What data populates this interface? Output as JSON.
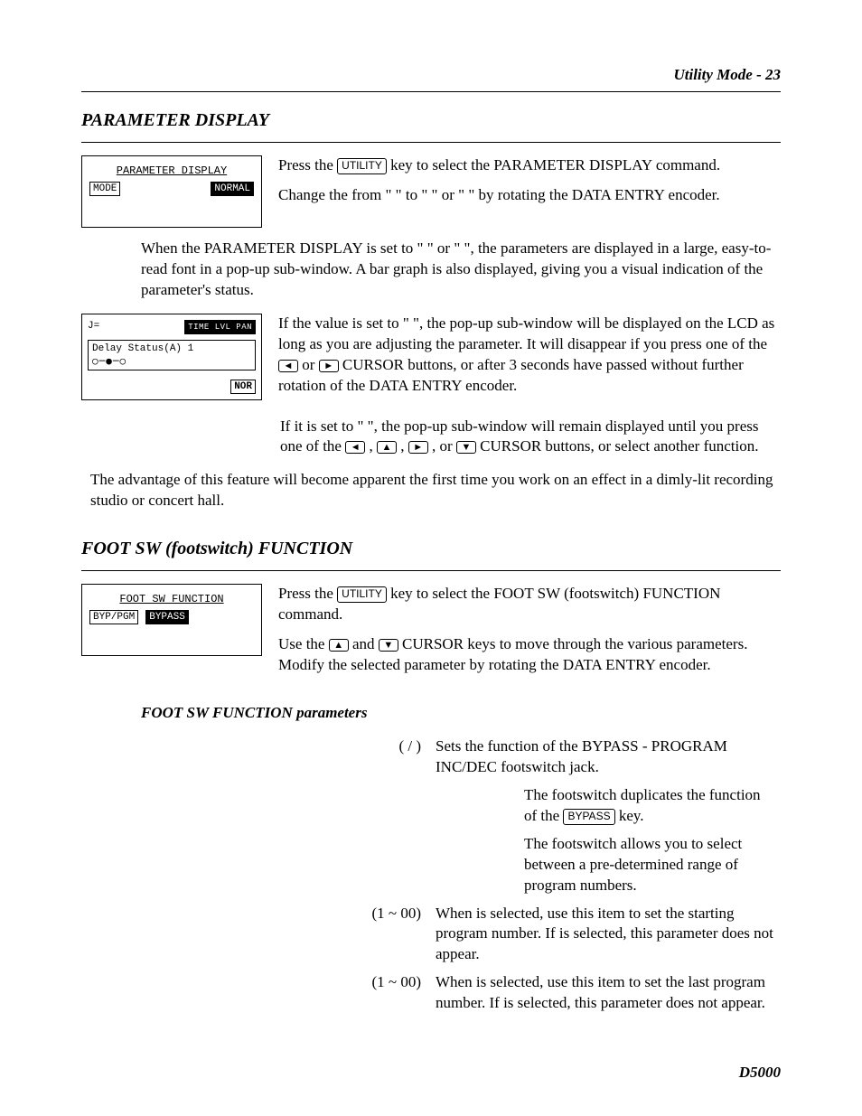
{
  "header": {
    "running_head": "Utility Mode - 23",
    "model": "D5000"
  },
  "section1": {
    "title": "PARAMETER DISPLAY",
    "lcd": {
      "title": "PARAMETER DISPLAY",
      "mode_label": "MODE",
      "mode_value": "NORMAL"
    },
    "para1_a": "Press the ",
    "key_utility": "UTILITY",
    "para1_b": " key to select the PARAMETER DISPLAY command.",
    "para2": "Change the         from \"             \" to \"                         \" or \"                           \" by rotating the DATA ENTRY encoder.",
    "para3": "When the PARAMETER DISPLAY is set to \"                          \" or \"                          \", the parameters are displayed in a large, easy-to-read font in a pop-up sub-window. A bar graph is also displayed, giving you a visual indication of the parameter's status.",
    "lcd2": {
      "top_left": "J=",
      "top_right_tabs": "TIME  LVL  PAN",
      "box_line": "Delay Status(A) 1",
      "slider": "○─●─○",
      "bottom_right": "NOR"
    },
    "para4_a": "If the value is set to \"                                \", the pop-up sub-window will be displayed on the LCD as long as you are adjusting the parameter. It will disappear if you press one of the ",
    "para4_b": " or ",
    "para4_c": " CURSOR buttons, or after 3 seconds have passed without further rotation of the DATA ENTRY encoder.",
    "para5_a": "If it is set to \"                               \", the pop-up sub-window will remain displayed until you press one of the ",
    "para5_b": " , ",
    "para5_c": " , ",
    "para5_d": " , or ",
    "para5_e": " CURSOR buttons, or select another function.",
    "para6": "The advantage of this feature will become apparent the first time you work on an effect in a dimly-lit recording studio or concert hall."
  },
  "section2": {
    "title": "FOOT SW (footswitch) FUNCTION",
    "lcd": {
      "title": "FOOT SW FUNCTION",
      "left_label": "BYP/PGM",
      "right_label": "BYPASS"
    },
    "para1_a": "Press the ",
    "key_utility": "UTILITY",
    "para1_b": " key to select the FOOT SW (footswitch) FUNCTION command.",
    "para2_a": "Use the ",
    "para2_b": " and ",
    "para2_c": " CURSOR keys to move through the various parameters. Modify the selected parameter by rotating the DATA ENTRY encoder.",
    "subheading": "FOOT SW FUNCTION parameters",
    "rows": {
      "r1_name": "(          /          )",
      "r1_desc": "Sets the function of the BYPASS - PROGRAM INC/DEC footswitch jack.",
      "r2_name": "",
      "r2_desc_a": "The footswitch duplicates the function of the ",
      "key_bypass": "BYPASS",
      "r2_desc_b": " key.",
      "r3_name": "",
      "r3_desc": "The footswitch allows you to select between a pre-determined range of program numbers.",
      "r4_name": "(1 ~ 00)",
      "r4_desc": "When               is selected, use this item to set the starting program number. If               is selected, this parameter does not appear.",
      "r5_name": "(1 ~ 00)",
      "r5_desc": "When               is selected, use this item to set the last program number. If               is selected, this parameter does not appear."
    }
  }
}
